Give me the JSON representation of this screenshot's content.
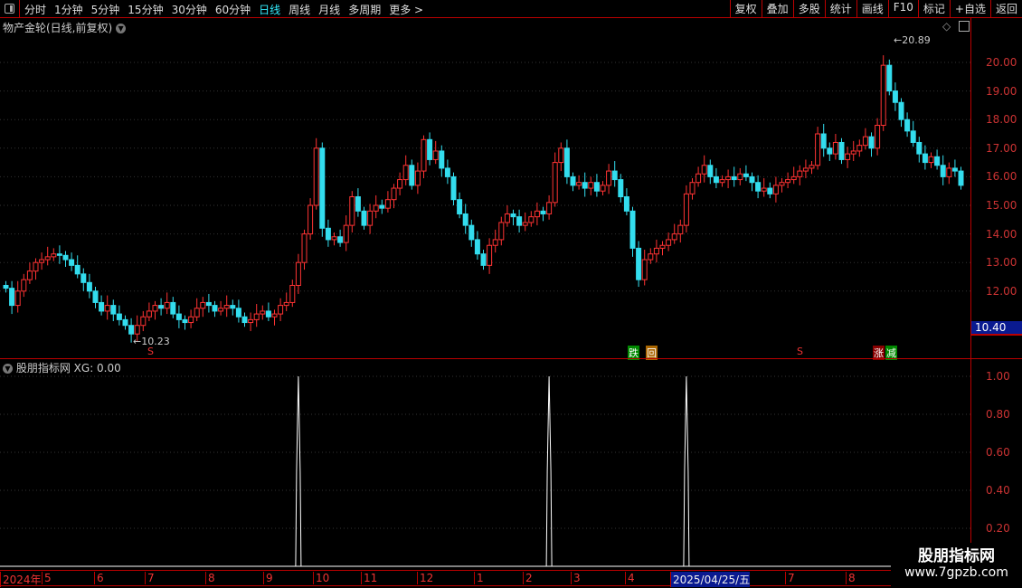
{
  "toolbar": {
    "tabs": [
      "分时",
      "1分钟",
      "5分钟",
      "15分钟",
      "30分钟",
      "60分钟",
      "日线",
      "周线",
      "月线",
      "多周期",
      "更多 >"
    ],
    "active": "日线",
    "buttons": [
      "复权",
      "叠加",
      "多股",
      "统计",
      "画线",
      "F10",
      "标记",
      "+自选",
      "返回"
    ]
  },
  "main": {
    "title": "物产金轮(日线,前复权)",
    "price_labels": [
      "20.00",
      "19.00",
      "18.00",
      "17.00",
      "16.00",
      "15.00",
      "14.00",
      "13.00",
      "12.00"
    ],
    "current_price": "10.40",
    "high_label": "20.89",
    "low_label": "10.23",
    "signals": [
      "跌",
      "回",
      "涨",
      "减"
    ],
    "s_marker": "S"
  },
  "indicator": {
    "title": "股朋指标网",
    "value_label": "XG: 0.00",
    "axis_labels": [
      "1.00",
      "0.80",
      "0.60",
      "0.40",
      "0.20"
    ]
  },
  "date_axis": [
    "2024年",
    "5",
    "6",
    "7",
    "8",
    "9",
    "10",
    "11",
    "12",
    "1",
    "2",
    "3",
    "4",
    "2025/04/25/五",
    "7",
    "8"
  ],
  "watermark": {
    "line1": "股朋指标网",
    "line2": "www.7gpzb.com"
  },
  "colors": {
    "up": "#ff3333",
    "down": "#33ddee",
    "frame": "#bb0000",
    "xg": "#ffffff"
  },
  "chart_data": {
    "type": "candlestick",
    "ylim": [
      10.0,
      21.0
    ],
    "closes": [
      12.1,
      11.5,
      12.0,
      12.4,
      12.7,
      13.0,
      13.1,
      13.2,
      13.3,
      13.25,
      13.1,
      12.9,
      12.6,
      12.3,
      12.0,
      11.6,
      11.3,
      11.5,
      11.2,
      11.0,
      10.8,
      10.5,
      10.8,
      11.1,
      11.3,
      11.5,
      11.4,
      11.6,
      11.2,
      11.0,
      10.9,
      11.1,
      11.4,
      11.6,
      11.5,
      11.3,
      11.4,
      11.5,
      11.4,
      11.1,
      10.9,
      11.0,
      11.2,
      11.3,
      11.1,
      11.2,
      11.5,
      11.6,
      12.2,
      13.0,
      14.0,
      15.0,
      17.0,
      14.2,
      13.8,
      13.9,
      13.7,
      14.3,
      15.3,
      14.8,
      14.3,
      14.8,
      15.0,
      14.9,
      15.2,
      15.6,
      15.9,
      16.4,
      15.7,
      16.2,
      17.3,
      16.6,
      16.9,
      16.3,
      16.0,
      15.2,
      14.7,
      14.3,
      13.8,
      13.3,
      12.9,
      13.6,
      13.8,
      14.4,
      14.7,
      14.6,
      14.3,
      14.4,
      14.6,
      14.8,
      14.7,
      15.1,
      16.5,
      17.0,
      16.0,
      15.7,
      15.8,
      15.6,
      15.8,
      15.5,
      15.7,
      16.2,
      15.9,
      15.3,
      14.8,
      13.5,
      12.4,
      13.1,
      13.3,
      13.5,
      13.6,
      13.8,
      14.0,
      14.3,
      15.4,
      15.8,
      16.1,
      16.4,
      16.0,
      15.8,
      15.9,
      16.0,
      15.9,
      16.1,
      16.0,
      15.8,
      15.5,
      15.6,
      15.4,
      15.7,
      15.8,
      15.9,
      16.0,
      16.2,
      16.3,
      16.4,
      17.5,
      17.0,
      16.8,
      17.2,
      16.6,
      16.8,
      16.9,
      17.1,
      17.4,
      17.0,
      17.8,
      19.9,
      19.0,
      18.6,
      18.0,
      17.6,
      17.2,
      16.8,
      16.5,
      16.7,
      16.4,
      16.0,
      16.3,
      16.2,
      15.7
    ],
    "xg_signal_indices": [
      49,
      91,
      114
    ],
    "xg_ylim": [
      0,
      1
    ]
  }
}
